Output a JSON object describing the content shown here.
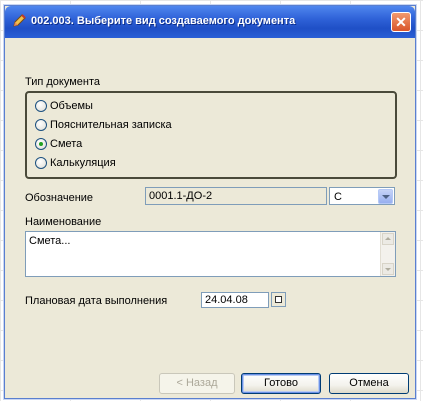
{
  "dialog": {
    "title": "002.003. Выберите вид создаваемого документа",
    "icon": "pencil-icon",
    "close_glyph": "✕"
  },
  "document_type": {
    "label": "Тип документа",
    "options": [
      {
        "label": "Объемы",
        "checked": false
      },
      {
        "label": "Пояснительная записка",
        "checked": false
      },
      {
        "label": "Смета",
        "checked": true
      },
      {
        "label": "Калькуляция",
        "checked": false
      }
    ]
  },
  "designation": {
    "label": "Обозначение",
    "value": "0001.1-ДО-2",
    "suffix_value": "С"
  },
  "name": {
    "label": "Наименование",
    "value": "Смета..."
  },
  "planned_date": {
    "label": "Плановая дата выполнения",
    "value": "24.04.08"
  },
  "buttons": {
    "back": "< Назад",
    "done": "Готово",
    "cancel": "Отмена"
  },
  "colors": {
    "titlebar": "#2f62d8",
    "dialog_bg": "#ece9d8",
    "radio_checked": "#21a121"
  }
}
